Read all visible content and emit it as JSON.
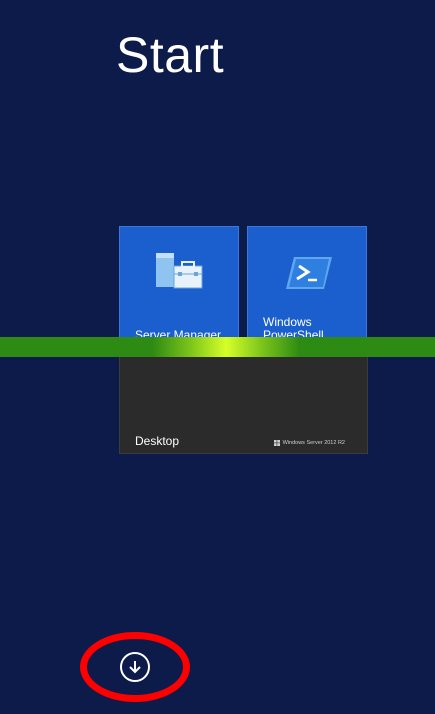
{
  "screen": {
    "title": "Start",
    "background_color": "#0d1b4a"
  },
  "tiles": [
    {
      "label": "Server Manager",
      "icon": "server-manager-icon",
      "color": "#1b5fcf"
    },
    {
      "label": "Windows PowerShell",
      "icon": "powershell-icon",
      "color": "#1b5fcf"
    },
    {
      "label": "Desktop",
      "watermark": "Windows Server 2012 R2",
      "color": "#2b2b2b"
    }
  ],
  "loading_bar": {
    "color": "#2d8a12",
    "highlight_color": "#d6ff28"
  },
  "apps_button": {
    "icon": "down-arrow-icon"
  },
  "annotation": {
    "color": "#ff0000"
  }
}
